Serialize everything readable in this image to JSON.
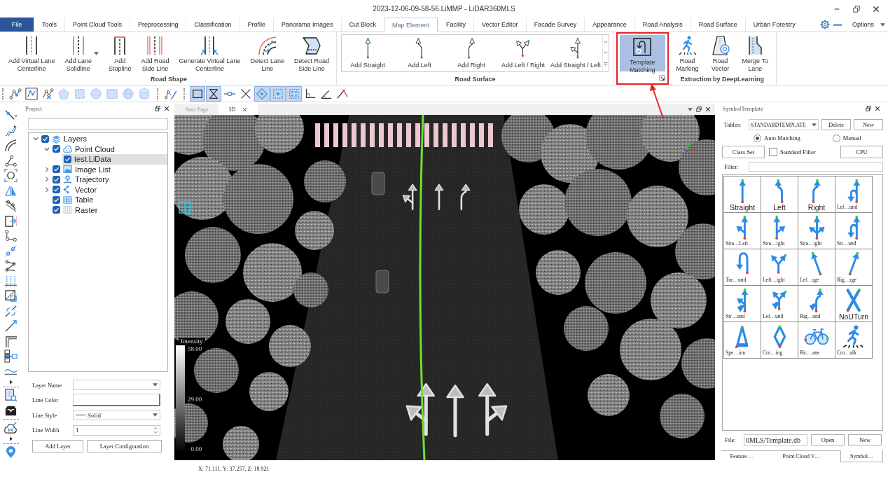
{
  "window": {
    "title": "2023-12-06-09-58-56.LiMMP - LiDAR360MLS"
  },
  "menu_tabs": [
    {
      "label": "File",
      "kind": "file",
      "selected": false
    },
    {
      "label": "Tools",
      "kind": "tab",
      "selected": false
    },
    {
      "label": "Point Cloud Tools",
      "kind": "tab",
      "selected": false
    },
    {
      "label": "Preprocessing",
      "kind": "tab",
      "selected": false
    },
    {
      "label": "Classification",
      "kind": "tab",
      "selected": false
    },
    {
      "label": "Profile",
      "kind": "tab",
      "selected": false
    },
    {
      "label": "Panorama Images",
      "kind": "tab",
      "selected": false
    },
    {
      "label": "Cut Block",
      "kind": "tab",
      "selected": false
    },
    {
      "label": "Map Element",
      "kind": "tab",
      "selected": true
    },
    {
      "label": "Facility",
      "kind": "tab",
      "selected": false
    },
    {
      "label": "Vector Editor",
      "kind": "tab",
      "selected": false
    },
    {
      "label": "Facade Survey",
      "kind": "tab",
      "selected": false
    },
    {
      "label": "Appearance",
      "kind": "tab",
      "selected": false
    },
    {
      "label": "Road Analysis",
      "kind": "tab",
      "selected": false
    },
    {
      "label": "Road Surface",
      "kind": "tab",
      "selected": false
    },
    {
      "label": "Urban Forestry",
      "kind": "tab",
      "selected": false
    }
  ],
  "options_menu": {
    "label": "Options"
  },
  "ribbon": [
    {
      "label": "Road Shape",
      "kind": "plain",
      "buttons": [
        {
          "label": "Add Virtual Lane\nCenterline",
          "kind": "virtual",
          "selected": false
        },
        {
          "label": "Add Lane\nSolidline",
          "kind": "solid",
          "selected": false,
          "dropdown": true
        },
        {
          "label": "Add\nStopline",
          "kind": "stopline",
          "selected": false
        },
        {
          "label": "Add Road\nSide Line",
          "kind": "sideline",
          "selected": false
        },
        {
          "label": "Generate Virtual Lane\nCenterline",
          "kind": "generate",
          "selected": false
        },
        {
          "label": "Detect Lane\nLine",
          "kind": "detectlane",
          "selected": false
        },
        {
          "label": "Detect Road\nSide Line",
          "kind": "detectroad",
          "selected": false
        }
      ]
    },
    {
      "label": "Road Surface",
      "kind": "gallery",
      "buttons": [
        {
          "label": "Add Straight",
          "kind": "straight",
          "selected": false
        },
        {
          "label": "Add Left",
          "kind": "left",
          "selected": false
        },
        {
          "label": "Add Right",
          "kind": "right",
          "selected": false
        },
        {
          "label": "Add Left / Right",
          "kind": "leftright",
          "selected": false
        },
        {
          "label": "Add Straight / Left",
          "kind": "straightleft",
          "selected": false
        }
      ]
    },
    {
      "kind": "plain",
      "launcher": true,
      "annotated": true,
      "buttons": [
        {
          "label": "Template\nMatching",
          "kind": "template",
          "selected": true
        }
      ]
    },
    {
      "label": "Extraction by DeepLearning",
      "kind": "plain",
      "buttons": [
        {
          "label": "Road\nMarking",
          "kind": "marking",
          "selected": false
        },
        {
          "label": "Road\nVector",
          "kind": "vector",
          "selected": false
        },
        {
          "label": "Merge To\nLane",
          "kind": "merge",
          "selected": false
        }
      ]
    }
  ],
  "toolbar": [
    {
      "tools": [
        {
          "kind": "polyline",
          "selected": false
        },
        {
          "kind": "nodeselect",
          "selected": false
        },
        {
          "kind": "nodedelete",
          "selected": false
        },
        {
          "kind": "pentagon",
          "selected": false
        },
        {
          "kind": "dashedsquare",
          "selected": false
        },
        {
          "kind": "circle",
          "selected": false
        },
        {
          "kind": "square",
          "selected": false
        },
        {
          "kind": "sphere",
          "selected": false
        },
        {
          "kind": "cylinder",
          "selected": false
        }
      ]
    },
    {
      "tools": [
        {
          "kind": "nodepen",
          "selected": false
        }
      ]
    },
    {
      "tools": [
        {
          "kind": "rectangle",
          "selected": true
        },
        {
          "kind": "hourglass",
          "selected": true
        },
        {
          "kind": "linenode",
          "selected": false
        },
        {
          "kind": "crosslines",
          "selected": false
        },
        {
          "kind": "movepoints",
          "selected": true
        },
        {
          "kind": "dottedframe",
          "selected": true
        },
        {
          "kind": "dottedgrid",
          "selected": true
        },
        {
          "kind": "axiscorner",
          "selected": false
        },
        {
          "kind": "angle",
          "selected": false
        },
        {
          "kind": "anglemarker",
          "selected": false
        }
      ]
    }
  ],
  "project_panel": {
    "title": "Project",
    "tree": [
      {
        "label": "Layers",
        "kind": "layers",
        "expanded": true,
        "checked": true,
        "selected": false,
        "children": [
          {
            "label": "Point Cloud",
            "kind": "pointcloud",
            "expanded": true,
            "checked": true,
            "selected": false,
            "children": [
              {
                "label": "test.LiData",
                "checked": true,
                "selected": true
              }
            ]
          },
          {
            "label": "Image List",
            "kind": "images",
            "expanded": false,
            "checked": true,
            "selected": false
          },
          {
            "label": "Trajectory",
            "kind": "trajectory",
            "expanded": false,
            "checked": true,
            "selected": false
          },
          {
            "label": "Vector",
            "kind": "vector",
            "expanded": false,
            "checked": true,
            "selected": false
          },
          {
            "label": "Table",
            "kind": "table",
            "checked": true,
            "selected": false
          },
          {
            "label": "Raster",
            "kind": "raster",
            "checked": true,
            "selected": false
          }
        ]
      }
    ],
    "fields": [
      {
        "label": "Layer Name",
        "kind": "dropdown"
      },
      {
        "label": "Line Color",
        "kind": "color"
      },
      {
        "label": "Line Style",
        "kind": "linestyle",
        "value": "Solid"
      },
      {
        "label": "Line Width",
        "kind": "spin",
        "value": "1"
      }
    ],
    "buttons": [
      "Add Layer",
      "Layer Configuration"
    ]
  },
  "documents": {
    "tabs": [
      {
        "label": "Start Page",
        "selected": false
      },
      {
        "label": "3D",
        "selected": true
      }
    ]
  },
  "view": {
    "legend": {
      "title": "Intensity",
      "ticks": [
        "58.00",
        "29.00",
        "0.00"
      ]
    }
  },
  "status_bar": {
    "coordinates": "X: 71.111, Y: 37.257, Z: 18.921"
  },
  "symbol_panel": {
    "title": "SymbolTemplate",
    "tables_label": "Tables:",
    "table_value": "STANDARDTEMPLATE",
    "table_buttons": [
      "Delete",
      "New"
    ],
    "modes": [
      {
        "label": "Auto Matching",
        "selected": true
      },
      {
        "label": "Manual",
        "selected": false
      }
    ],
    "class_set_button": "Class Set",
    "standard_filter": {
      "label": "Standard Filter",
      "checked": false
    },
    "device_button": "CPU",
    "filter_label": "Filter:",
    "symbols": [
      {
        "label": "Straight",
        "kind": "straight",
        "large": true
      },
      {
        "label": "Left",
        "kind": "left",
        "large": true
      },
      {
        "label": "Right",
        "kind": "right",
        "large": true
      },
      {
        "label": "Lef…und",
        "kind": "leftuturn",
        "large": false
      },
      {
        "label": "Stra…Left",
        "kind": "straightleft",
        "large": false
      },
      {
        "label": "Stra…ight",
        "kind": "straightright",
        "large": false
      },
      {
        "label": "Stra…ight",
        "kind": "straightleftright",
        "large": false
      },
      {
        "label": "Str…und",
        "kind": "straightuturn",
        "large": false
      },
      {
        "label": "Tur…und",
        "kind": "uturn",
        "large": false
      },
      {
        "label": "Left…ight",
        "kind": "leftright",
        "large": false
      },
      {
        "label": "Lef…rge",
        "kind": "leftmerge",
        "large": false
      },
      {
        "label": "Rig…rge",
        "kind": "rightmerge",
        "large": false
      },
      {
        "label": "Str…und",
        "kind": "straightleftuturn",
        "large": false
      },
      {
        "label": "Lef…und",
        "kind": "leftrightuturn",
        "large": false
      },
      {
        "label": "Rig…und",
        "kind": "rightuturn",
        "large": false
      },
      {
        "label": "NoUTurn",
        "kind": "nouturn",
        "large": true
      },
      {
        "label": "Spe…ion",
        "kind": "speedbump",
        "large": false
      },
      {
        "label": "Cro…ing",
        "kind": "crossing",
        "large": false
      },
      {
        "label": "Bic…ane",
        "kind": "bicycle",
        "large": false
      },
      {
        "label": "Cro…alk",
        "kind": "crosswalk",
        "large": false
      }
    ],
    "file_label": "File:",
    "file_value": "0MLS/Template.db",
    "file_buttons": [
      "Open",
      "New"
    ]
  },
  "dock_tabs": [
    {
      "label": "Feature …",
      "selected": false
    },
    {
      "label": "Point Cloud V…",
      "selected": false
    },
    {
      "label": "Symbol…",
      "selected": true
    }
  ]
}
